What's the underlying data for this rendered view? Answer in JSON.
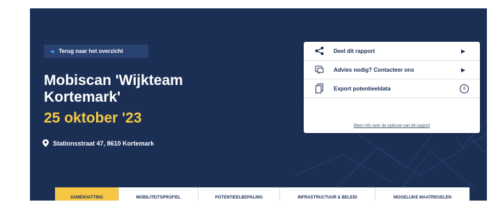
{
  "hero": {
    "back_label": "Terug naar het overzicht",
    "title": "Mobiscan 'Wijkteam Kortemark'",
    "date": "25 oktober '23",
    "address": "Stationsstraat 47, 8610 Kortemark"
  },
  "panel": {
    "items": [
      {
        "label": "Deel dit rapport",
        "icon": "share-icon"
      },
      {
        "label": "Advies nodig? Contacteer ons",
        "icon": "chat-icon"
      },
      {
        "label": "Export potentieeldata",
        "icon": "document-icon"
      }
    ],
    "info_link": "Meer info over de opbouw van dit rapport"
  },
  "tabs": [
    {
      "label": "SAMENVATTING",
      "active": true
    },
    {
      "label": "MOBILITEITSPROFIEL",
      "active": false
    },
    {
      "label": "POTENTIEELBEPALING",
      "active": false
    },
    {
      "label": "INFRASTRUCTUUR & BELEID",
      "active": false
    },
    {
      "label": "MOGELIJKE MAATREGELEN",
      "active": false
    }
  ],
  "colors": {
    "hero_bg": "#1b2f55",
    "accent_yellow": "#f6c744",
    "back_btn_bg": "#2a4270",
    "chevron_blue": "#3fa4ff"
  }
}
